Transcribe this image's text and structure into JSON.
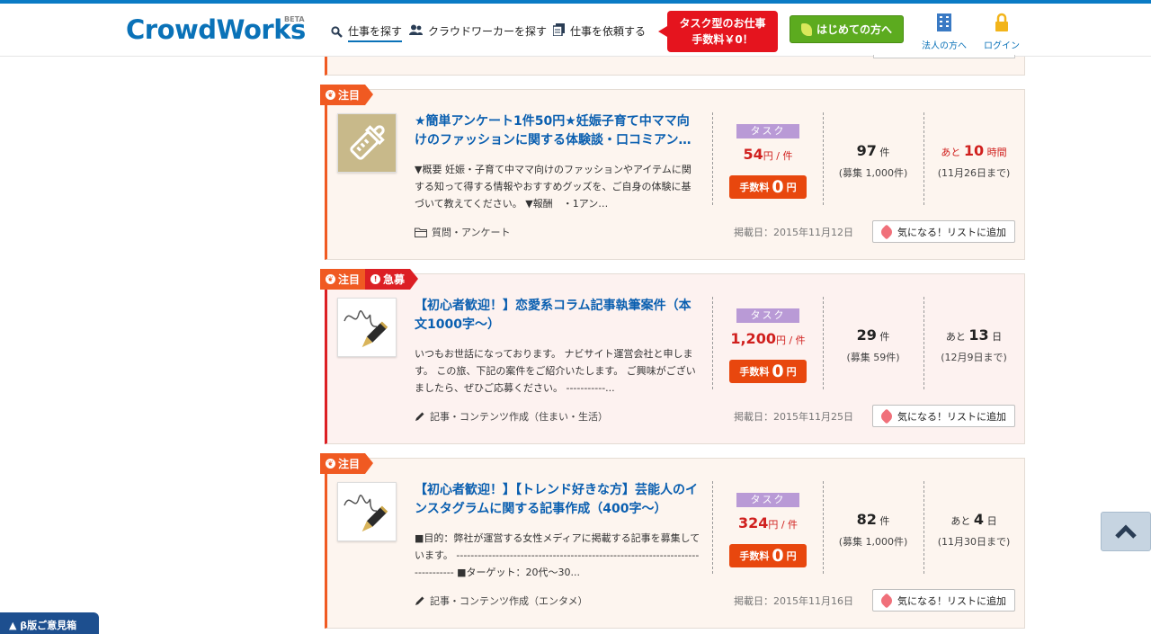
{
  "header": {
    "logo": "CrowdWorks",
    "logo_badge": "BETA",
    "nav": [
      {
        "label": "仕事を探す",
        "icon": "search-icon"
      },
      {
        "label": "クラウドワーカーを探す",
        "icon": "users-icon"
      },
      {
        "label": "仕事を依頼する",
        "icon": "document-icon"
      }
    ],
    "promo_line1": "タスク型のお仕事",
    "promo_line2": "手数料￥0！",
    "beginner_button": "はじめての方へ",
    "corporate_link": "法人の方へ",
    "login_link": "ログイン"
  },
  "feedback_tab": "▲ β版ご意見箱",
  "common": {
    "task_label": "タスク",
    "fee_label": "手数料",
    "fee_zero": "0",
    "fee_unit": "円",
    "price_unit": "円 / 件",
    "count_unit": "件",
    "attention_badge": "注目",
    "urgent_badge": "急募",
    "favorite_button": "気になる！リストに追加"
  },
  "jobs": [
    {
      "title": "★簡単アンケート1件50円★妊娠子育て中ママ向けのファッションに関する体験談・口コミアン…",
      "description": "▼概要 妊娠・子育て中ママ向けのファッションやアイテムに関する知って得する情報やおすすめグッズを、ご自身の体験に基づいて教えてください。 ▼報酬　・1アン…",
      "category": "質問・アンケート",
      "price": "54",
      "count": "97",
      "recruit": "(募集 1,000件)",
      "deadline_prefix": "あと",
      "deadline_num": "10",
      "deadline_unit": "時間",
      "deadline_date": "(11月26日まで)",
      "posted": "掲載日：2015年11月12日",
      "thumb_icon": "baby-bottle-icon",
      "category_icon": "folder-icon"
    },
    {
      "title": "【初心者歓迎！】恋愛系コラム記事執筆案件（本文1000字〜）",
      "description": "いつもお世話になっております。 ナビサイト運営会社と申します。 この旅、下記の案件をご紹介いたします。 ご興味がございましたら、ぜひご応募ください。 -----------...",
      "category": "記事・コンテンツ作成（住まい・生活）",
      "price": "1,200",
      "count": "29",
      "recruit": "(募集 59件)",
      "deadline_prefix": "あと",
      "deadline_num": "13",
      "deadline_unit": "日",
      "deadline_date": "(12月9日まで)",
      "posted": "掲載日：2015年11月25日",
      "thumb_icon": "fountain-pen-icon",
      "category_icon": "pencil-icon"
    },
    {
      "title": "【初心者歓迎！】【トレンド好きな方】芸能人のインスタグラムに関する記事作成（400字〜）",
      "description": "■目的：弊社が運営する女性メディアに掲載する記事を募集しています。 ------------------------------------------------------------------------------- ■ターゲット：20代〜30...",
      "category": "記事・コンテンツ作成（エンタメ）",
      "price": "324",
      "count": "82",
      "recruit": "(募集 1,000件)",
      "deadline_prefix": "あと",
      "deadline_num": "4",
      "deadline_unit": "日",
      "deadline_date": "(11月30日まで)",
      "posted": "掲載日：2015年11月16日",
      "thumb_icon": "fountain-pen-icon",
      "category_icon": "pencil-icon"
    }
  ],
  "colors": {
    "brand": "#0a72b8",
    "attention": "#f05a22",
    "urgent": "#dc1f24",
    "price": "#d0201e",
    "task_tag": "#b99ad6"
  }
}
